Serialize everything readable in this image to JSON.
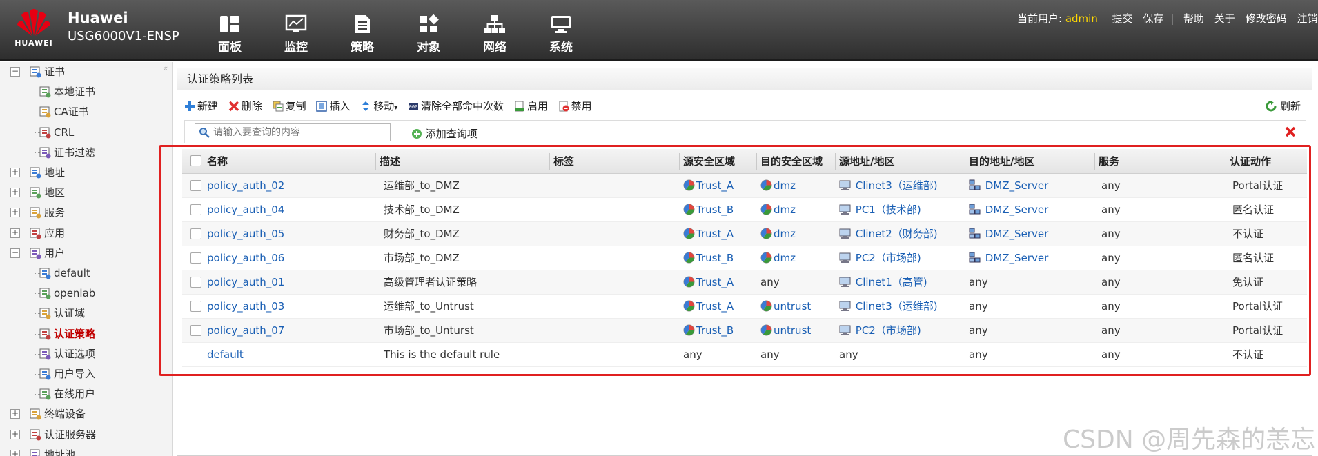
{
  "brand": {
    "logo_text": "HUAWEI",
    "name": "Huawei",
    "model": "USG6000V1-ENSP"
  },
  "nav": [
    {
      "label": "面板",
      "icon": "dashboard-icon"
    },
    {
      "label": "监控",
      "icon": "monitor-icon"
    },
    {
      "label": "策略",
      "icon": "policy-icon"
    },
    {
      "label": "对象",
      "icon": "object-icon",
      "active": true
    },
    {
      "label": "网络",
      "icon": "network-icon"
    },
    {
      "label": "系统",
      "icon": "system-icon"
    }
  ],
  "userbar": {
    "current_user_label": "当前用户:",
    "username": "admin",
    "links": [
      "提交",
      "保存",
      "帮助",
      "关于",
      "修改密码",
      "注销"
    ]
  },
  "sidebar": {
    "items": [
      {
        "label": "证书",
        "level": 0,
        "toggle": "−",
        "icon": "certificate-icon"
      },
      {
        "label": "本地证书",
        "level": 1,
        "icon": "local-cert-icon"
      },
      {
        "label": "CA证书",
        "level": 1,
        "icon": "ca-cert-icon"
      },
      {
        "label": "CRL",
        "level": 1,
        "icon": "crl-icon"
      },
      {
        "label": "证书过滤",
        "level": 1,
        "icon": "cert-filter-icon"
      },
      {
        "label": "地址",
        "level": 0,
        "toggle": "+",
        "icon": "address-icon"
      },
      {
        "label": "地区",
        "level": 0,
        "toggle": "+",
        "icon": "region-icon"
      },
      {
        "label": "服务",
        "level": 0,
        "toggle": "+",
        "icon": "service-icon"
      },
      {
        "label": "应用",
        "level": 0,
        "toggle": "+",
        "icon": "application-icon"
      },
      {
        "label": "用户",
        "level": 0,
        "toggle": "−",
        "icon": "user-icon"
      },
      {
        "label": "default",
        "level": 1,
        "icon": "user-default-icon"
      },
      {
        "label": "openlab",
        "level": 1,
        "icon": "user-openlab-icon"
      },
      {
        "label": "认证域",
        "level": 1,
        "icon": "auth-domain-icon"
      },
      {
        "label": "认证策略",
        "level": 1,
        "icon": "auth-policy-icon",
        "selected": true
      },
      {
        "label": "认证选项",
        "level": 1,
        "icon": "auth-option-icon"
      },
      {
        "label": "用户导入",
        "level": 1,
        "icon": "user-import-icon"
      },
      {
        "label": "在线用户",
        "level": 1,
        "icon": "online-user-icon"
      },
      {
        "label": "终端设备",
        "level": 0,
        "toggle": "+",
        "icon": "terminal-device-icon"
      },
      {
        "label": "认证服务器",
        "level": 0,
        "toggle": "+",
        "icon": "auth-server-icon"
      },
      {
        "label": "地址池",
        "level": 0,
        "toggle": "+",
        "icon": "address-pool-icon"
      }
    ]
  },
  "panel": {
    "title": "认证策略列表",
    "toolbar": [
      {
        "label": "新建",
        "icon": "add-icon"
      },
      {
        "label": "删除",
        "icon": "delete-icon"
      },
      {
        "label": "复制",
        "icon": "copy-icon"
      },
      {
        "label": "插入",
        "icon": "insert-icon"
      },
      {
        "label": "移动",
        "icon": "move-icon"
      },
      {
        "label": "清除全部命中次数",
        "icon": "clear-hits-icon"
      },
      {
        "label": "启用",
        "icon": "enable-icon"
      },
      {
        "label": "禁用",
        "icon": "disable-icon"
      }
    ],
    "refresh_label": "刷新",
    "search_placeholder": "请输入要查询的内容",
    "add_query_label": "添加查询项"
  },
  "table": {
    "headers": [
      "名称",
      "描述",
      "标签",
      "源安全区域",
      "目的安全区域",
      "源地址/地区",
      "目的地址/地区",
      "服务",
      "认证动作"
    ],
    "rows": [
      {
        "name": "policy_auth_02",
        "desc": "运维部_to_DMZ",
        "tag": "",
        "src_zone": "Trust_A",
        "dst_zone": "dmz",
        "src_addr": "Clinet3（运维部)",
        "dst_addr": "DMZ_Server",
        "service": "any",
        "action": "Portal认证"
      },
      {
        "name": "policy_auth_04",
        "desc": "技术部_to_DMZ",
        "tag": "",
        "src_zone": "Trust_B",
        "dst_zone": "dmz",
        "src_addr": "PC1（技术部)",
        "dst_addr": "DMZ_Server",
        "service": "any",
        "action": "匿名认证"
      },
      {
        "name": "policy_auth_05",
        "desc": "财务部_to_DMZ",
        "tag": "",
        "src_zone": "Trust_A",
        "dst_zone": "dmz",
        "src_addr": "Clinet2（财务部)",
        "dst_addr": "DMZ_Server",
        "service": "any",
        "action": "不认证"
      },
      {
        "name": "policy_auth_06",
        "desc": "市场部_to_DMZ",
        "tag": "",
        "src_zone": "Trust_B",
        "dst_zone": "dmz",
        "src_addr": "PC2（市场部)",
        "dst_addr": "DMZ_Server",
        "service": "any",
        "action": "匿名认证"
      },
      {
        "name": "policy_auth_01",
        "desc": "高级管理者认证策略",
        "tag": "",
        "src_zone": "Trust_A",
        "dst_zone": "any",
        "src_addr": "Clinet1（高管)",
        "dst_addr": "any",
        "service": "any",
        "action": "免认证"
      },
      {
        "name": "policy_auth_03",
        "desc": "运维部_to_Untrust",
        "tag": "",
        "src_zone": "Trust_A",
        "dst_zone": "untrust",
        "src_addr": "Clinet3（运维部)",
        "dst_addr": "any",
        "service": "any",
        "action": "Portal认证"
      },
      {
        "name": "policy_auth_07",
        "desc": "市场部_to_Unturst",
        "tag": "",
        "src_zone": "Trust_B",
        "dst_zone": "untrust",
        "src_addr": "PC2（市场部)",
        "dst_addr": "any",
        "service": "any",
        "action": "Portal认证"
      },
      {
        "name": "default",
        "desc": "This is the default rule",
        "tag": "",
        "src_zone": "any",
        "dst_zone": "any",
        "src_addr": "any",
        "dst_addr": "any",
        "service": "any",
        "action": "不认证"
      }
    ]
  },
  "watermark": "CSDN @周先森的恙忘",
  "colors": {
    "accent_link": "#1a5fb4",
    "highlight_border": "#e02020",
    "admin_name": "#ffd800",
    "selected_tree": "#c00000"
  }
}
